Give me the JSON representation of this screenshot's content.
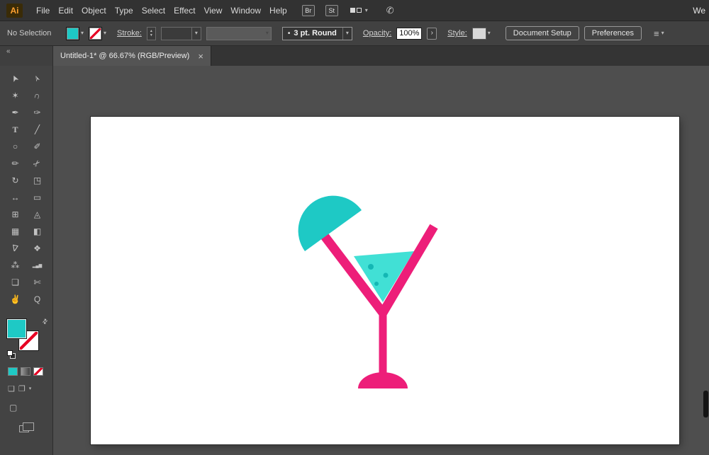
{
  "colors": {
    "fill_teal": "#1ec9c5",
    "liquid_teal": "#41e0d5",
    "dot_teal": "#14b7b4",
    "glass_pink": "#ed1e79"
  },
  "menubar": {
    "logo": "Ai",
    "menus": [
      "File",
      "Edit",
      "Object",
      "Type",
      "Select",
      "Effect",
      "View",
      "Window",
      "Help"
    ],
    "bridge_label": "Br",
    "stock_label": "St",
    "workspace_clipped_label": "We"
  },
  "controlbar": {
    "selection_status": "No Selection",
    "stroke_label": "Stroke:",
    "stroke_weight_value": "",
    "width_profile_value": "3 pt. Round",
    "opacity_label": "Opacity:",
    "opacity_value": "100%",
    "style_label": "Style:",
    "document_setup": "Document Setup",
    "preferences": "Preferences"
  },
  "tabbar": {
    "collapse": "«",
    "title": "Untitled-1* @ 66.67% (RGB/Preview)",
    "close": "×"
  },
  "toolbar": {
    "tools": [
      {
        "name": "selection-tool",
        "glyph": "➤",
        "rot": -115
      },
      {
        "name": "direct-selection-tool",
        "glyph": "➢",
        "rot": -115
      },
      {
        "name": "magic-wand-tool",
        "glyph": "✶",
        "rot": 0
      },
      {
        "name": "lasso-tool",
        "glyph": "∩",
        "rot": 15
      },
      {
        "name": "pen-tool",
        "glyph": "✒",
        "rot": 0
      },
      {
        "name": "curvature-tool",
        "glyph": "✑",
        "rot": 0
      },
      {
        "name": "type-tool",
        "glyph": "T",
        "rot": 0
      },
      {
        "name": "line-tool",
        "glyph": "╱",
        "rot": 0
      },
      {
        "name": "ellipse-tool",
        "glyph": "○",
        "rot": 0
      },
      {
        "name": "paintbrush-tool",
        "glyph": "✐",
        "rot": 0
      },
      {
        "name": "pencil-tool",
        "glyph": "✏",
        "rot": 0
      },
      {
        "name": "scissors-tool",
        "glyph": "✂",
        "rot": -45
      },
      {
        "name": "rotate-tool",
        "glyph": "↻",
        "rot": 0
      },
      {
        "name": "scale-tool",
        "glyph": "◳",
        "rot": 0
      },
      {
        "name": "width-tool",
        "glyph": "↔",
        "rot": 0
      },
      {
        "name": "free-transform-tool",
        "glyph": "▭",
        "rot": 0
      },
      {
        "name": "shape-builder-tool",
        "glyph": "⊞",
        "rot": 0
      },
      {
        "name": "perspective-grid-tool",
        "glyph": "◬",
        "rot": 0
      },
      {
        "name": "mesh-tool",
        "glyph": "▦",
        "rot": 0
      },
      {
        "name": "gradient-tool",
        "glyph": "◧",
        "rot": 0
      },
      {
        "name": "eyedropper-tool",
        "glyph": "∇",
        "rot": 12
      },
      {
        "name": "blend-tool",
        "glyph": "❖",
        "rot": 0
      },
      {
        "name": "symbol-sprayer-tool",
        "glyph": "⁂",
        "rot": 0
      },
      {
        "name": "column-graph-tool",
        "glyph": "▂▄▆",
        "rot": 0,
        "small": true
      },
      {
        "name": "artboard-tool",
        "glyph": "❏",
        "rot": 0
      },
      {
        "name": "slice-tool",
        "glyph": "✄",
        "rot": 0
      },
      {
        "name": "hand-tool",
        "glyph": "✌",
        "rot": 0
      },
      {
        "name": "zoom-tool",
        "glyph": "Q",
        "rot": 0
      }
    ]
  },
  "icons": {
    "chevron_down": "▾",
    "swap_arrows": "⇄",
    "share": "✆",
    "stepper_up": "▲",
    "stepper_down": "▼",
    "opacity_more": "›",
    "panel_menu": "≡",
    "width_profile_bullet": "•",
    "draw_normal": "❏",
    "draw_inside": "❐",
    "screen_mode": "▢"
  }
}
